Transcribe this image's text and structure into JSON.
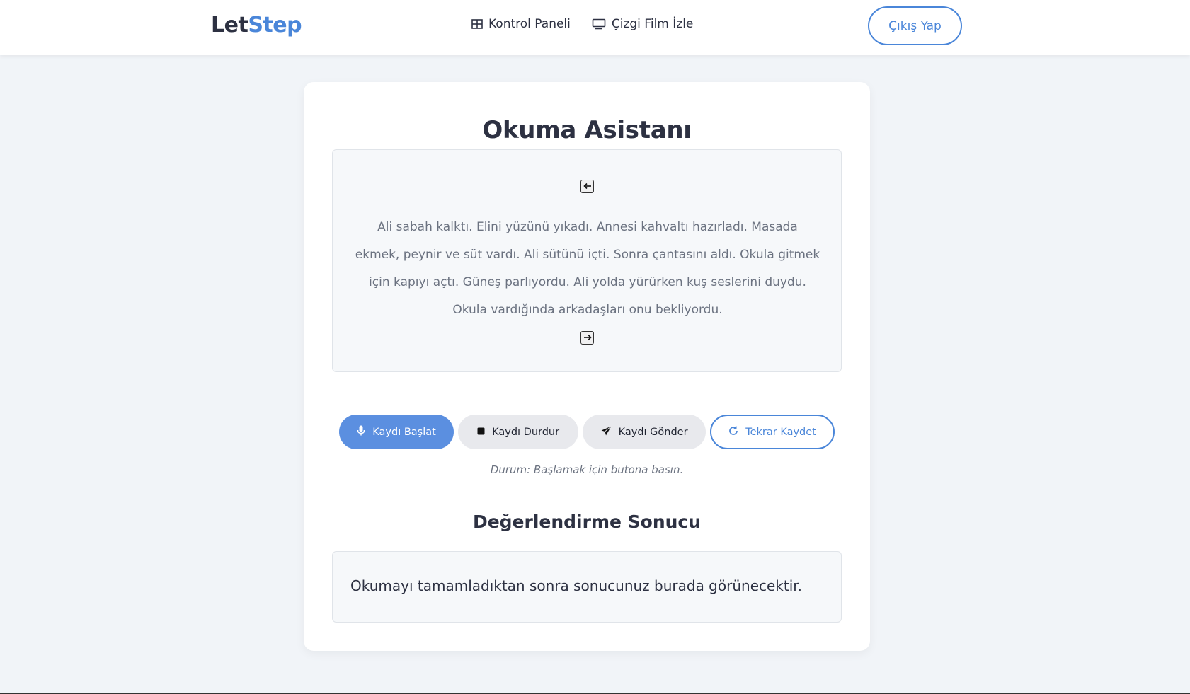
{
  "header": {
    "logo_part1": "Let",
    "logo_part2": "Step",
    "nav": [
      {
        "label": "Kontrol Paneli",
        "icon": "grid-icon"
      },
      {
        "label": "Çizgi Film İzle",
        "icon": "monitor-icon"
      }
    ],
    "logout_label": "Çıkış Yap"
  },
  "main": {
    "title": "Okuma Asistanı",
    "reading_text": "Ali sabah kalktı. Elini yüzünü yıkadı. Annesi kahvaltı hazırladı. Masada ekmek, peynir ve süt vardı. Ali sütünü içti. Sonra çantasını aldı. Okula gitmek için kapıyı açtı. Güneş parlıyordu. Ali yolda yürürken kuş seslerini duydu. Okula vardığında arkadaşları onu bekliyordu.",
    "buttons": {
      "start": "Kaydı Başlat",
      "stop": "Kaydı Durdur",
      "send": "Kaydı Gönder",
      "retry": "Tekrar Kaydet"
    },
    "status": "Durum: Başlamak için butona basın.",
    "result_title": "Değerlendirme Sonucu",
    "result_text": "Okumayı tamamladıktan sonra sonucunuz burada görünecektir."
  },
  "colors": {
    "accent": "#4a86d9",
    "primary_button": "#5b8fe0",
    "background": "#f1f4f8"
  }
}
